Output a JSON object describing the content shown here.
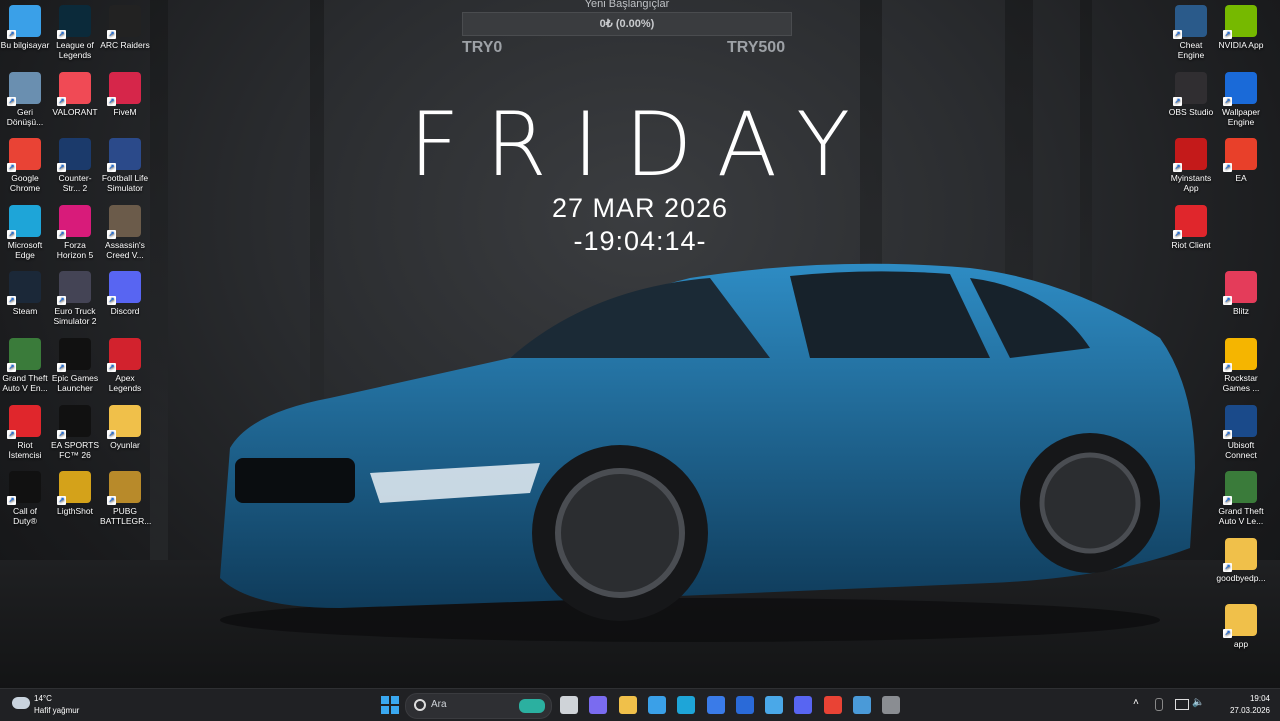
{
  "widget": {
    "title": "Yeni Başlangıçlar",
    "amount": "0₺ (0.00%)",
    "progress": 0,
    "goal_left": "TRY0",
    "goal_right": "TRY500"
  },
  "clock": {
    "day": "FRIDAY",
    "date": "27 MAR 2026",
    "time": "-19:04:14-"
  },
  "desktop_left": [
    {
      "label": "Bu bilgisayar",
      "icon": "monitor-icon",
      "color": "#3aa0e8"
    },
    {
      "label": "League of Legends",
      "icon": "lol-icon",
      "color": "#0b2a3a"
    },
    {
      "label": "ARC Raiders",
      "icon": "arc-raiders-icon",
      "color": "#222"
    },
    {
      "label": "Geri Dönüşü...",
      "icon": "recycle-bin-icon",
      "color": "#6a8fb0"
    },
    {
      "label": "VALORANT",
      "icon": "valorant-icon",
      "color": "#f04a55"
    },
    {
      "label": "FiveM",
      "icon": "fivem-icon",
      "color": "#d6264a"
    },
    {
      "label": "Google Chrome",
      "icon": "chrome-icon",
      "color": "#e94335"
    },
    {
      "label": "Counter-Str... 2",
      "icon": "cs2-icon",
      "color": "#1b3a6b"
    },
    {
      "label": "Football Life Simulator",
      "icon": "fls-icon",
      "color": "#2b4a8a"
    },
    {
      "label": "Microsoft Edge",
      "icon": "edge-icon",
      "color": "#1ea5d8"
    },
    {
      "label": "Forza Horizon 5",
      "icon": "forza-icon",
      "color": "#d81b7a"
    },
    {
      "label": "Assassin's Creed V...",
      "icon": "ac-icon",
      "color": "#6b5b4a"
    },
    {
      "label": "Steam",
      "icon": "steam-icon",
      "color": "#1b2838"
    },
    {
      "label": "Euro Truck Simulator 2",
      "icon": "ets2-icon",
      "color": "#445"
    },
    {
      "label": "Discord",
      "icon": "discord-icon",
      "color": "#5865f2"
    },
    {
      "label": "Grand Theft Auto V En...",
      "icon": "gta-icon",
      "color": "#3a7b3a"
    },
    {
      "label": "Epic Games Launcher",
      "icon": "epic-icon",
      "color": "#111"
    },
    {
      "label": "Apex Legends",
      "icon": "apex-icon",
      "color": "#d2222d"
    },
    {
      "label": "Riot İstemcisi",
      "icon": "riot-icon",
      "color": "#e0262c"
    },
    {
      "label": "EA SPORTS FC™ 26",
      "icon": "eafc-icon",
      "color": "#111"
    },
    {
      "label": "Oyunlar",
      "icon": "folder-icon",
      "color": "#f0c04a"
    },
    {
      "label": "Call of Duty®",
      "icon": "cod-icon",
      "color": "#111"
    },
    {
      "label": "LigthShot",
      "icon": "lightshot-icon",
      "color": "#d4a21a"
    },
    {
      "label": "PUBG BATTLEGR...",
      "icon": "pubg-icon",
      "color": "#b88a2a"
    }
  ],
  "desktop_right": [
    {
      "label": "Cheat Engine",
      "icon": "cheat-engine-icon",
      "color": "#2a5a8a"
    },
    {
      "label": "NVIDIA App",
      "icon": "nvidia-icon",
      "color": "#76b900"
    },
    {
      "label": "OBS Studio",
      "icon": "obs-icon",
      "color": "#302e31"
    },
    {
      "label": "Wallpaper Engine",
      "icon": "wallpaper-engine-icon",
      "color": "#1a6ad8"
    },
    {
      "label": "Myinstants App",
      "icon": "myinstants-icon",
      "color": "#c41a1a"
    },
    {
      "label": "EA",
      "icon": "ea-icon",
      "color": "#e8402a"
    },
    {
      "label": "Riot Client",
      "icon": "riot-client-icon",
      "color": "#e0262c"
    },
    {
      "label": "Blitz",
      "icon": "blitz-icon",
      "color": "#e43c5a"
    },
    {
      "label": "Rockstar Games ...",
      "icon": "rockstar-icon",
      "color": "#f5b500"
    },
    {
      "label": "Ubisoft Connect",
      "icon": "ubisoft-icon",
      "color": "#1a4a8a"
    },
    {
      "label": "Grand Theft Auto V Le...",
      "icon": "gta-icon",
      "color": "#3a7b3a"
    },
    {
      "label": "goodbyedp...",
      "icon": "folder-icon",
      "color": "#f0c04a"
    },
    {
      "label": "app",
      "icon": "folder-icon",
      "color": "#f0c04a"
    }
  ],
  "taskbar": {
    "weather_temp": "14°C",
    "weather_desc": "Hafif yağmur",
    "search_placeholder": "Ara",
    "time": "19:04",
    "date": "27.03.2026",
    "apps": [
      {
        "name": "task-view-icon",
        "color": "#cfd3d8"
      },
      {
        "name": "copilot-icon",
        "color": "#7a6bf0"
      },
      {
        "name": "file-explorer-icon",
        "color": "#f0c04a"
      },
      {
        "name": "photos-icon",
        "color": "#3aa0e8"
      },
      {
        "name": "edge-taskbar-icon",
        "color": "#1ea5d8"
      },
      {
        "name": "store-icon",
        "color": "#3a7be8"
      },
      {
        "name": "mail-icon",
        "color": "#2a6ad8"
      },
      {
        "name": "gallery-icon",
        "color": "#4aa8e8"
      },
      {
        "name": "discord-taskbar-icon",
        "color": "#5865f2"
      },
      {
        "name": "chrome-taskbar-icon",
        "color": "#e94335"
      },
      {
        "name": "app-taskbar-icon-1",
        "color": "#4a9ad8"
      },
      {
        "name": "app-taskbar-icon-2",
        "color": "#8a8d92"
      }
    ]
  }
}
